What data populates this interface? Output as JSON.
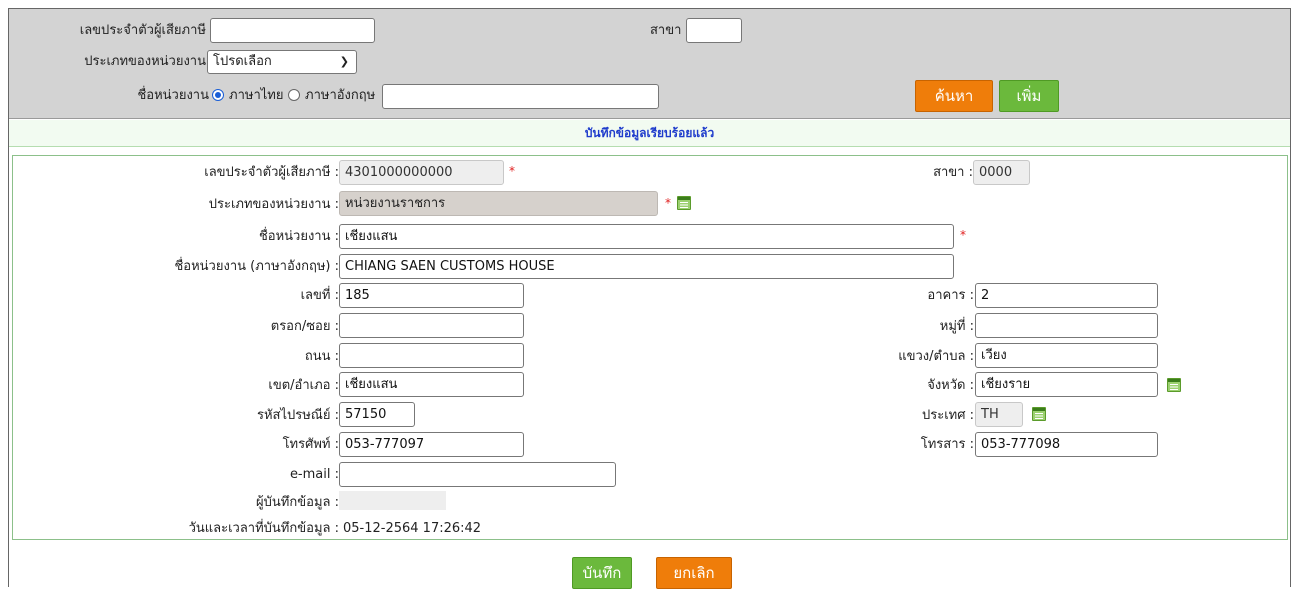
{
  "search": {
    "tax_id_label": "เลขประจำตัวผู้เสียภาษี",
    "tax_id_value": "",
    "branch_label": "สาขา",
    "branch_value": "",
    "unit_type_label": "ประเภทของหน่วยงาน",
    "unit_type_selected": "โปรดเลือก",
    "unit_name_label": "ชื่อหน่วยงาน",
    "radio_thai": "ภาษาไทย",
    "radio_english": "ภาษาอังกฤษ",
    "unit_name_value": "",
    "search_button": "ค้นหา",
    "add_button": "เพิ่ม"
  },
  "message": "บันทึกข้อมูลเรียบร้อยแล้ว",
  "form": {
    "tax_id_label": "เลขประจำตัวผู้เสียภาษี :",
    "tax_id_value": "4301000000000",
    "branch_label": "สาขา :",
    "branch_value": "0000",
    "unit_type_label": "ประเภทของหน่วยงาน :",
    "unit_type_value": "หน่วยงานราชการ",
    "unit_name_label": "ชื่อหน่วยงาน :",
    "unit_name_value": "เชียงแสน",
    "unit_name_en_label": "ชื่อหน่วยงาน (ภาษาอังกฤษ) :",
    "unit_name_en_value": "CHIANG SAEN CUSTOMS HOUSE",
    "number_label": "เลขที่ :",
    "number_value": "185",
    "building_label": "อาคาร :",
    "building_value": "2",
    "alley_label": "ตรอก/ซอย :",
    "alley_value": "",
    "moo_label": "หมู่ที่ :",
    "moo_value": "",
    "road_label": "ถนน :",
    "road_value": "",
    "subdistrict_label": "แขวง/ตำบล :",
    "subdistrict_value": "เวียง",
    "district_label": "เขต/อำเภอ :",
    "district_value": "เชียงแสน",
    "province_label": "จังหวัด :",
    "province_value": "เชียงราย",
    "postcode_label": "รหัสไปรษณีย์ :",
    "postcode_value": "57150",
    "country_label": "ประเทศ :",
    "country_value": "TH",
    "phone_label": "โทรศัพท์ :",
    "phone_value": "053-777097",
    "fax_label": "โทรสาร :",
    "fax_value": "053-777098",
    "email_label": "e-mail :",
    "email_value": "",
    "recorder_label": "ผู้บันทึกข้อมูล :",
    "recorder_value": "",
    "datetime_label": "วันและเวลาที่บันทึกข้อมูล :",
    "datetime_value": "05-12-2564 17:26:42",
    "required_mark": "*"
  },
  "actions": {
    "save_button": "บันทึก",
    "cancel_button": "ยกเลิก"
  },
  "colors": {
    "search_bg": "#d3d3d3",
    "orange_button": "#ef7d0a",
    "green_button": "#6bb93c",
    "message_text": "#1f3ccc",
    "required": "#e02020"
  },
  "icons": [
    "calendar-list-icon",
    "chevron-down-icon"
  ]
}
